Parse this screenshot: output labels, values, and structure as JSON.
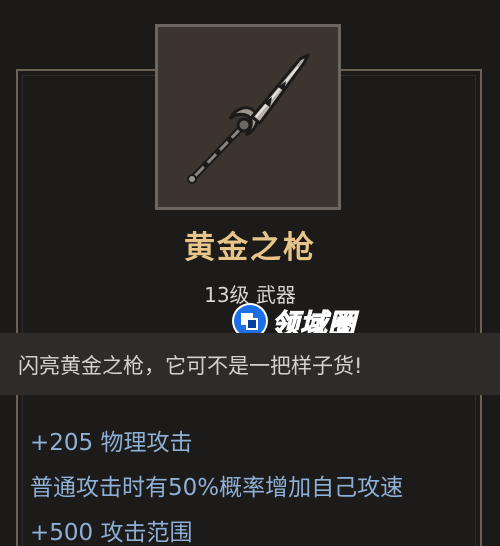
{
  "item": {
    "name": "黄金之枪",
    "meta": "13级 武器",
    "icon": "golden-spear-icon",
    "name_color": "#e7c48a"
  },
  "watermark": {
    "text": "领域圈"
  },
  "flavor": {
    "text": "闪亮黄金之枪，它可不是一把样子货!"
  },
  "stats": [
    "+205 物理攻击",
    "普通攻击时有50%概率增加自己攻速",
    "+500 攻击范围"
  ],
  "colors": {
    "stat_text": "#8fb0d6",
    "border": "#6b6152",
    "background": "#1b1a19"
  }
}
